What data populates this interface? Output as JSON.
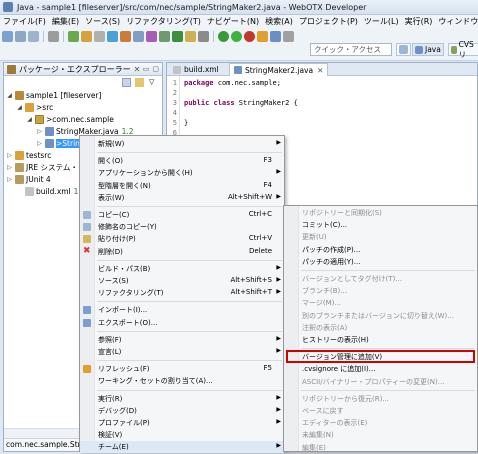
{
  "window": {
    "title": "Java - sample1  [fileserver]/src/com/nec/sample/StringMaker2.java - WebOTX Developer"
  },
  "menubar": [
    "ファイル(F)",
    "編集(E)",
    "ソース(S)",
    "リファクタリング(T)",
    "ナビゲート(N)",
    "検索(A)",
    "プロジェクト(P)",
    "ツール(L)",
    "実行(R)",
    "ウィンドウ(W)",
    "ヘルプ(H)"
  ],
  "toolbar": {
    "quick_access_placeholder": "クイック・アクセス",
    "perspective_java": "Java",
    "perspective_cvs": "CVS リ"
  },
  "explorer": {
    "tab_label": "パッケージ・エクスプローラー",
    "tree": [
      {
        "label": "sample1  [fileserver]",
        "twisty": "◢",
        "icon": "proj"
      },
      {
        "label": ">src",
        "twisty": "◢",
        "icon": "pkg"
      },
      {
        "label": ">com.nec.sample",
        "twisty": "◢",
        "icon": "pkg2"
      },
      {
        "label": "StringMaker.java",
        "version": "1.2",
        "twisty": "▷",
        "icon": "java"
      },
      {
        "label": ">StringMaker2.java",
        "twisty": "▷",
        "icon": "java",
        "selected": true
      },
      {
        "label": "testsrc",
        "twisty": "▷",
        "icon": "pkg"
      },
      {
        "label": "JRE システム・",
        "twisty": "▷",
        "icon": "lib"
      },
      {
        "label": "JUnit 4",
        "twisty": "▷",
        "icon": "lib"
      },
      {
        "label": "build.xml",
        "version": "1.4",
        "twisty": "",
        "icon": "xml"
      }
    ],
    "status": "com.nec.sample.StringMaker2.java"
  },
  "editor": {
    "tabs": [
      "build.xml",
      "StringMaker2.java"
    ],
    "code": [
      {
        "n": "1",
        "kw": "package",
        "text": " com.nec.sample;"
      },
      {
        "n": "2",
        "kw": "",
        "text": ""
      },
      {
        "n": "3",
        "kw": "public class",
        "text": " StringMaker2 {"
      },
      {
        "n": "4",
        "kw": "",
        "text": ""
      },
      {
        "n": "5",
        "kw": "",
        "text": "}"
      },
      {
        "n": "6",
        "kw": "",
        "text": ""
      }
    ]
  },
  "context_menu": [
    {
      "label": "新規(W)",
      "arrow": true
    },
    {
      "sep": true
    },
    {
      "label": "開く(O)",
      "shortcut": "F3"
    },
    {
      "label": "アプリケーションから開く(H)",
      "arrow": true
    },
    {
      "label": "型階層を開く(N)",
      "shortcut": "F4"
    },
    {
      "label": "表示(W)",
      "shortcut": "Alt+Shift+W",
      "arrow": true
    },
    {
      "sep": true
    },
    {
      "label": "コピー(C)",
      "shortcut": "Ctrl+C",
      "icon": "copy"
    },
    {
      "label": "修飾名のコピー(Y)",
      "icon": "copy"
    },
    {
      "label": "貼り付け(P)",
      "shortcut": "Ctrl+V",
      "icon": "paste"
    },
    {
      "label": "削除(D)",
      "shortcut": "Delete",
      "icon": "delete"
    },
    {
      "sep": true
    },
    {
      "label": "ビルド・パス(B)",
      "arrow": true
    },
    {
      "label": "ソース(S)",
      "shortcut": "Alt+Shift+S",
      "arrow": true
    },
    {
      "label": "リファクタリング(T)",
      "shortcut": "Alt+Shift+T",
      "arrow": true
    },
    {
      "sep": true
    },
    {
      "label": "インポート(I)...",
      "icon": "import"
    },
    {
      "label": "エクスポート(O)...",
      "icon": "export"
    },
    {
      "sep": true
    },
    {
      "label": "参照(F)",
      "arrow": true
    },
    {
      "label": "宣言(L)",
      "arrow": true
    },
    {
      "sep": true
    },
    {
      "label": "リフレッシュ(F)",
      "shortcut": "F5",
      "icon": "refresh"
    },
    {
      "label": "ワーキング・セットの割り当て(A)..."
    },
    {
      "sep": true
    },
    {
      "label": "実行(R)",
      "arrow": true
    },
    {
      "label": "デバッグ(D)",
      "arrow": true
    },
    {
      "label": "プロファイル(P)",
      "arrow": true
    },
    {
      "label": "検証(V)"
    },
    {
      "label": "チーム(E)",
      "arrow": true,
      "hover": true
    }
  ],
  "team_submenu": [
    {
      "label": "リポジトリーと同期化(S)",
      "disabled": true
    },
    {
      "label": "コミット(C)..."
    },
    {
      "label": "更新(U)",
      "disabled": true
    },
    {
      "label": "パッチの作成(P)..."
    },
    {
      "label": "パッチの適用(Y)..."
    },
    {
      "sep": true
    },
    {
      "label": "バージョンとしてタグ付け(T)...",
      "disabled": true
    },
    {
      "label": "ブランチ(B)...",
      "disabled": true
    },
    {
      "label": "マージ(M)...",
      "disabled": true
    },
    {
      "label": "別のブランチまたはバージョンに切り替え(W)...",
      "disabled": true
    },
    {
      "label": "注釈の表示(A)",
      "disabled": true
    },
    {
      "label": "ヒストリーの表示(H)"
    },
    {
      "sep": true
    },
    {
      "label": "バージョン管理に追加(V)",
      "highlight": true
    },
    {
      "label": ".cvsignore に追加(I)..."
    },
    {
      "label": "ASCII/バイナリー・プロパティーの変更(N)...",
      "disabled": true
    },
    {
      "sep": true
    },
    {
      "label": "リポジトリーから復元(R)...",
      "disabled": true
    },
    {
      "label": "ベースに戻す",
      "disabled": true
    },
    {
      "label": "エディターの表示(E)",
      "disabled": true
    },
    {
      "label": "未編集(N)",
      "disabled": true
    },
    {
      "label": "編集(E)",
      "disabled": true
    }
  ],
  "colors": {
    "selection": "#3399ff",
    "highlight_box": "#d40000",
    "keyword": "#7f0055"
  }
}
